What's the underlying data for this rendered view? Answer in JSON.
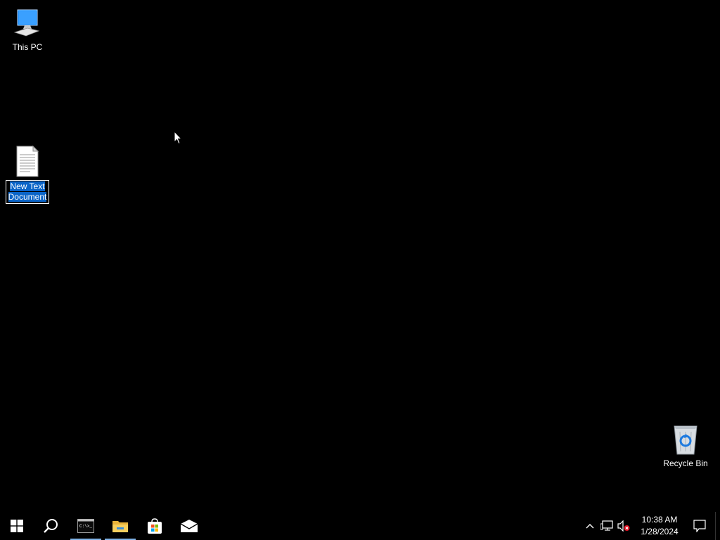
{
  "desktop": {
    "icons": [
      {
        "label": "This PC",
        "icon": "computer-icon"
      },
      {
        "label_lines": [
          "New Text",
          "Document"
        ],
        "icon": "text-document-icon",
        "selected": true
      },
      {
        "label": "Recycle Bin",
        "icon": "recycle-bin-icon"
      }
    ]
  },
  "taskbar": {
    "buttons": [
      {
        "name": "start-button",
        "icon": "windows-logo-icon"
      },
      {
        "name": "search-button",
        "icon": "search-icon"
      },
      {
        "name": "taskbar-command-prompt",
        "icon": "command-prompt-icon",
        "running": true
      },
      {
        "name": "taskbar-file-explorer",
        "icon": "folder-icon",
        "running": true
      },
      {
        "name": "taskbar-microsoft-store",
        "icon": "store-icon"
      },
      {
        "name": "taskbar-mail",
        "icon": "mail-icon"
      }
    ],
    "tray": {
      "icons": [
        "chevron-up-icon",
        "network-icon",
        "volume-muted-icon"
      ],
      "time": "10:38 AM",
      "date": "1/28/2024",
      "notification_icon": "notification-icon"
    }
  },
  "colors": {
    "desktop_bg": "#000000",
    "selection": "#0a64c8",
    "running_indicator": "#7fb2e5"
  }
}
